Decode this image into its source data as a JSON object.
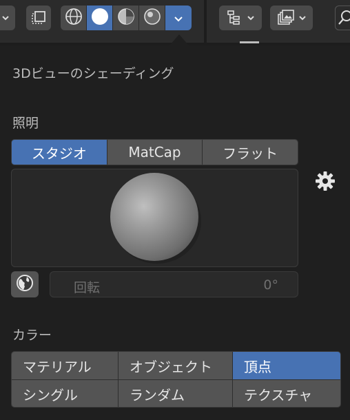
{
  "header": {
    "icons": [
      "chevron-down-icon",
      "toggle-xray-icon",
      "wireframe-shading-icon",
      "solid-shading-icon",
      "material-preview-icon",
      "rendered-shading-icon",
      "shading-dropdown-icon",
      "outliner-icon",
      "image-editor-icon",
      "search-icon"
    ]
  },
  "popover": {
    "title": "3Dビューのシェーディング",
    "lighting": {
      "label": "照明",
      "tabs": [
        "スタジオ",
        "MatCap",
        "フラット"
      ],
      "active_tab": "スタジオ",
      "rotation_label": "回転",
      "rotation_value": "0°"
    },
    "color": {
      "label": "カラー",
      "options": [
        "マテリアル",
        "オブジェクト",
        "頂点",
        "シングル",
        "ランダム",
        "テクスチャ"
      ],
      "active_option": "頂点"
    }
  },
  "colors": {
    "accent": "#4772b3",
    "panel_bg": "#1f1f1f",
    "button_bg": "#545454"
  }
}
